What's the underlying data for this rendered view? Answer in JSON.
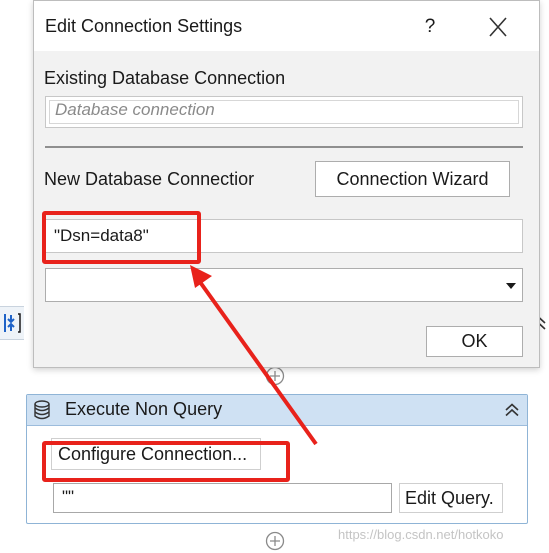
{
  "dialog": {
    "title": "Edit Connection Settings",
    "help_label": "?",
    "existing_label": "Existing Database Connection",
    "existing_placeholder": "Database connection",
    "new_label": "New Database Connectior",
    "wizard_label": "Connection Wizard",
    "connection_string": "\"Dsn=data8\"",
    "provider_value": "",
    "ok_label": "OK"
  },
  "activity": {
    "title": "Execute Non Query",
    "configure_label": "Configure Connection...",
    "query_value": "\"\"",
    "edit_query_label": "Edit Query."
  },
  "watermark": "https://blog.csdn.net/hotkoko",
  "colors": {
    "annotation": "#e8221b",
    "activity_header": "#cfe1f3",
    "activity_border": "#8fb4d6"
  },
  "icons": [
    "close-icon",
    "database-icon",
    "chevron-up-double-icon",
    "add-circle-icon",
    "dropdown-caret-icon"
  ]
}
